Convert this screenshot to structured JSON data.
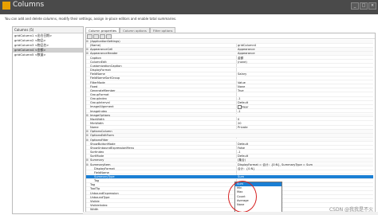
{
  "window": {
    "title": "Columns",
    "buttons": [
      "_",
      "□",
      "×"
    ]
  },
  "description": "You can add and delete columns, modify their settings, assign in-place editors and enable total summaries.",
  "columns_panel": {
    "header": "Columns (5)",
    "items": [
      "gridColumn1 <出仓日期>",
      "gridColumn2 <物品>",
      "gridColumn3 <物品名>",
      "gridColumn4 <金额>",
      "gridColumn5 <数量>"
    ],
    "selected_index": 3
  },
  "tabs": [
    "Column properties",
    "Column options",
    "Filter options"
  ],
  "properties": [
    {
      "name": "(ApplicationSettings)",
      "value": ""
    },
    {
      "name": "(Name)",
      "value": "gridColumn4"
    },
    {
      "name": "AppearanceCell",
      "value": "Appearance"
    },
    {
      "name": "AppearanceHeader",
      "value": "Appearance"
    },
    {
      "name": "Caption",
      "value": "金额"
    },
    {
      "name": "ColumnEdit",
      "value": "(none)"
    },
    {
      "name": "CustomizationCaption",
      "value": ""
    },
    {
      "name": "DisplayFormat",
      "value": ""
    },
    {
      "name": "FieldName",
      "value": "Salary"
    },
    {
      "name": "FieldNameSortGroup",
      "value": ""
    },
    {
      "name": "FilterMode",
      "value": "Value"
    },
    {
      "name": "Fixed",
      "value": "None"
    },
    {
      "name": "GenerateMember",
      "value": "True"
    },
    {
      "name": "GroupFormat",
      "value": ""
    },
    {
      "name": "GroupIndex",
      "value": "-1"
    },
    {
      "name": "GroupInterval",
      "value": "Default"
    },
    {
      "name": "ImageAlignment",
      "value": "Near"
    },
    {
      "name": "ImageIndex",
      "value": "-1"
    },
    {
      "name": "ImageOptions",
      "value": ""
    },
    {
      "name": "MaxWidth",
      "value": "0"
    },
    {
      "name": "MinWidth",
      "value": "20"
    },
    {
      "name": "Name",
      "value": "Private"
    },
    {
      "name": "OptionsColumn",
      "value": ""
    },
    {
      "name": "OptionsEditForm",
      "value": ""
    },
    {
      "name": "OptionsFilter",
      "value": ""
    },
    {
      "name": "ShowButtonMode",
      "value": "Default"
    },
    {
      "name": "ShowUnboundExpressionMenu",
      "value": "False"
    },
    {
      "name": "SortIndex",
      "value": "-1"
    },
    {
      "name": "SortMode",
      "value": "Default"
    },
    {
      "name": "Summary",
      "value": "(集合)"
    },
    {
      "name": "SummaryItem",
      "value": "DisplayFormat = 合计：{0:N}, SummaryType = Sum"
    },
    {
      "name": "DisplayFormat",
      "value": "合计：{0:N}"
    },
    {
      "name": "FieldName",
      "value": ""
    },
    {
      "name": "SummaryType",
      "value": "Sum"
    },
    {
      "name": "Tag",
      "value": ""
    },
    {
      "name": "Tag",
      "value": ""
    },
    {
      "name": "ToolTip",
      "value": ""
    },
    {
      "name": "UnboundExpression",
      "value": ""
    },
    {
      "name": "UnboundType",
      "value": ""
    },
    {
      "name": "Visible",
      "value": ""
    },
    {
      "name": "VisibleIndex",
      "value": ""
    },
    {
      "name": "Width",
      "value": ""
    }
  ],
  "dropdown": {
    "options": [
      "Sum",
      "Min",
      "Max",
      "Count",
      "Average",
      "None"
    ],
    "selected": 0
  },
  "watermark": "CSDN @我我是不火"
}
